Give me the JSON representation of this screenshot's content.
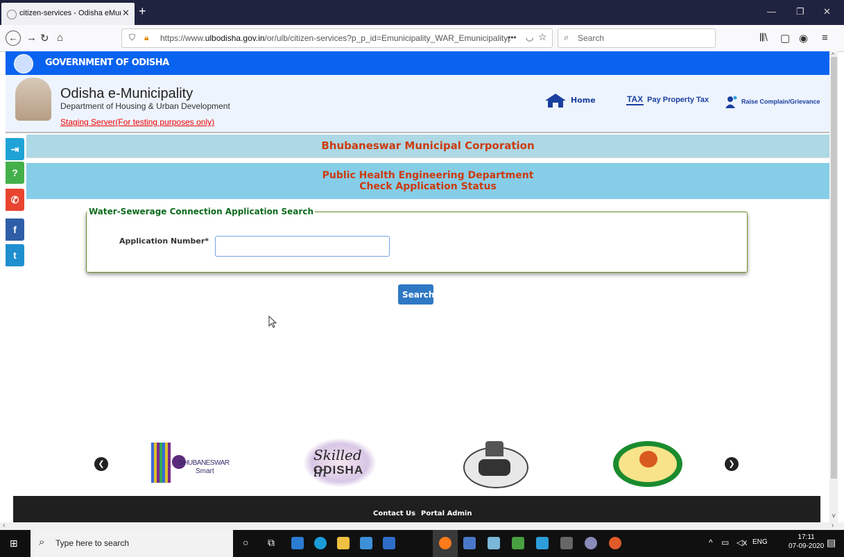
{
  "browser": {
    "tab_title": "citizen-services - Odisha eMuni",
    "url_prefix": "https://www.",
    "url_domain": "ulbodisha.gov.in",
    "url_rest": "/or/ulb/citizen-services?p_p_id=Emunicipality_WAR_Emunicipalitypo",
    "search_placeholder": "Search"
  },
  "site": {
    "gov_title": "GOVERNMENT OF ODISHA",
    "title": "Odisha e-Municipality",
    "subtitle": "Department of Housing & Urban Development",
    "staging": "Staging Server(For testing purposes only)",
    "nav": {
      "home": "Home",
      "tax": "Pay Property Tax",
      "tax_icon_text": "TAX",
      "complain": "Raise Complain/Grievance"
    },
    "corporation": "Bhubaneswar Municipal Corporation",
    "department": "Public Health Engineering Department",
    "page_heading": "Check Application Status"
  },
  "form": {
    "legend": "Water-Sewerage Connection Application Search",
    "app_label": "Application Number*",
    "app_value": "",
    "search_button": "Search"
  },
  "partners": {
    "bhubaneswar": "BHUBANESWAR",
    "smart": "Smart",
    "skilled_1": "Skilled in",
    "skilled_2": "ODISHA"
  },
  "footer": {
    "contact": "Contact Us",
    "admin": "Portal Admin"
  },
  "taskbar": {
    "search_placeholder": "Type here to search",
    "lang": "ENG",
    "time": "17:11",
    "date": "07-09-2020"
  },
  "colors": {
    "gov_bar": "#0a63f0",
    "corporation_text": "#cc3b0d",
    "legend_text": "#0d6b1d",
    "search_button": "#2f78c4"
  }
}
